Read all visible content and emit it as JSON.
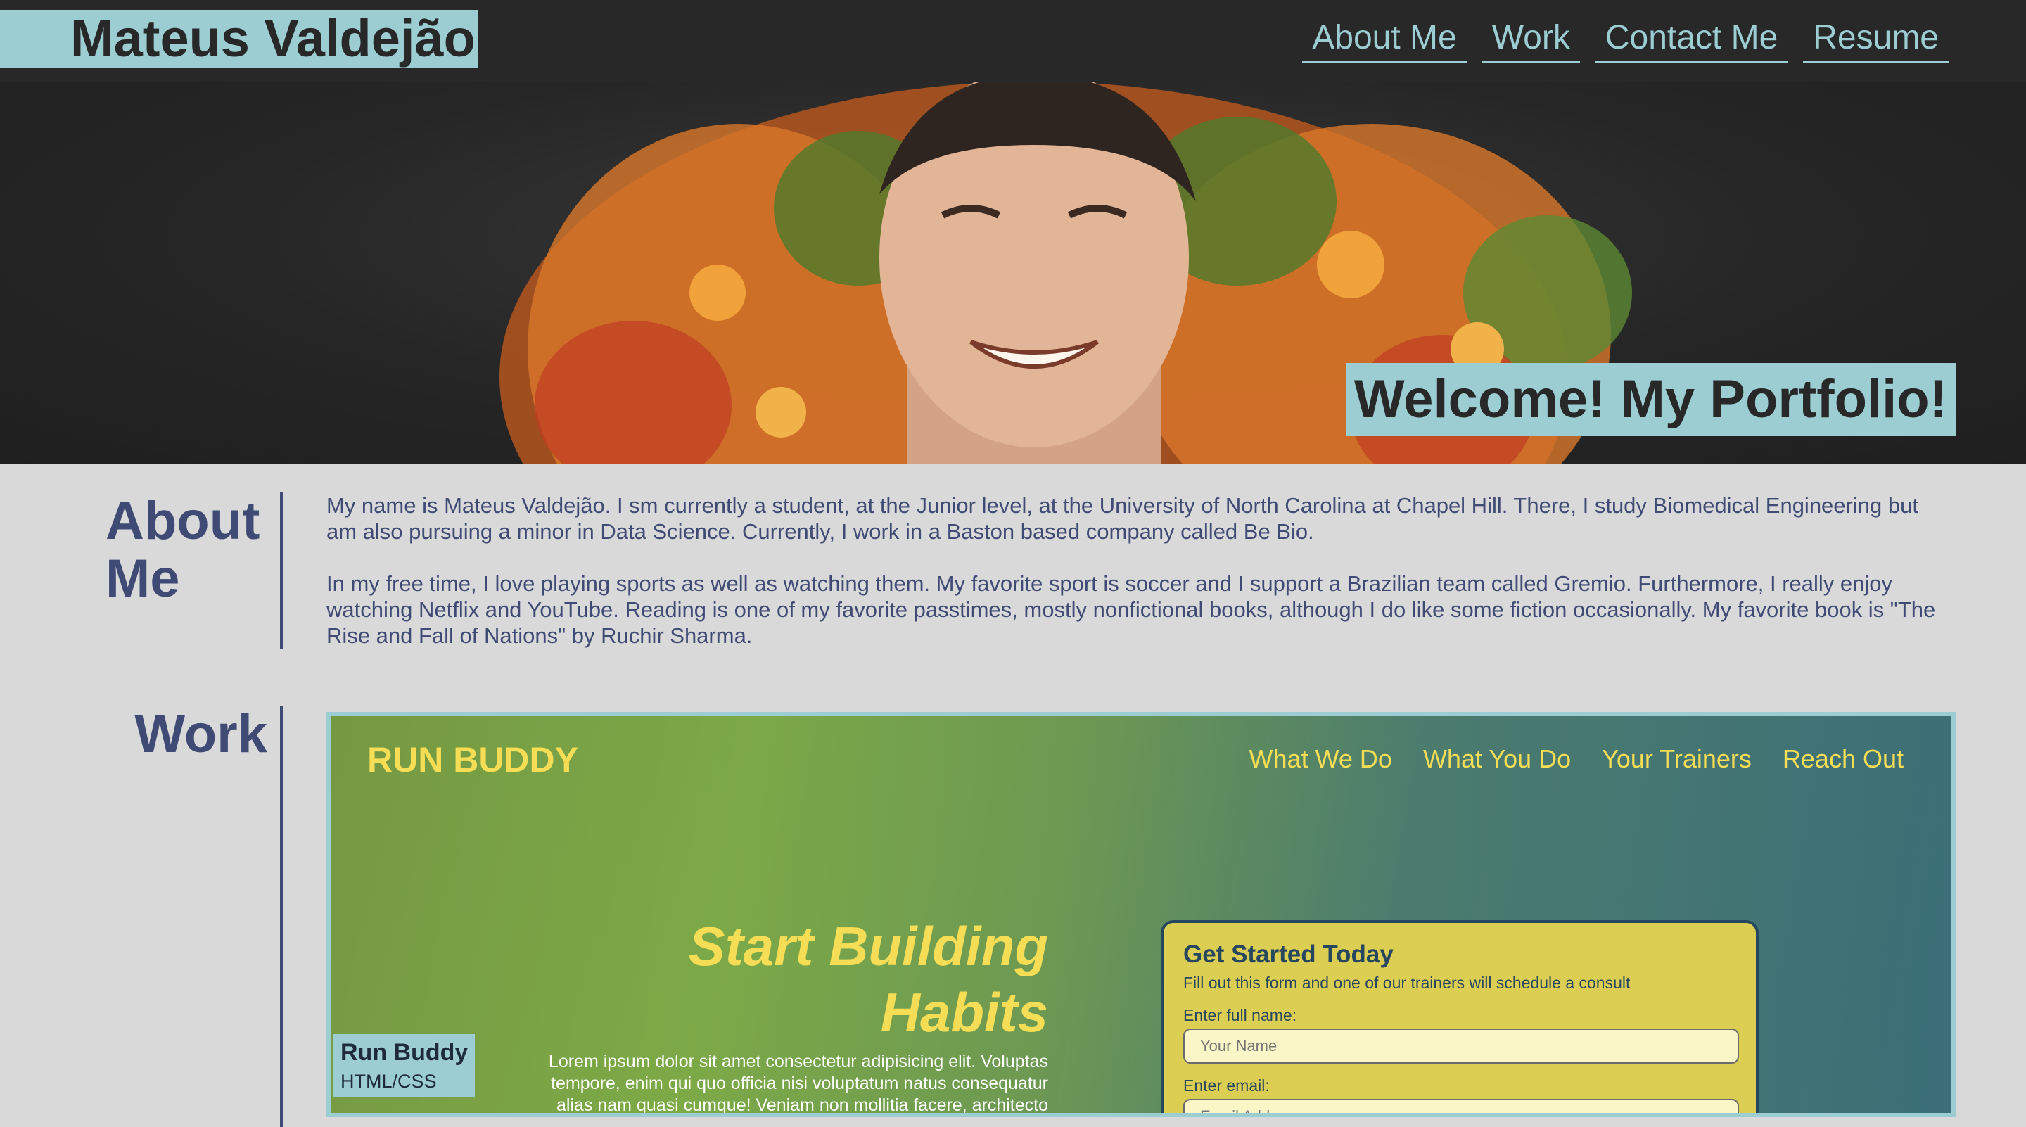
{
  "header": {
    "brand": "Mateus Valdejão",
    "nav": [
      "About Me",
      "Work",
      "Contact Me",
      "Resume"
    ]
  },
  "hero": {
    "welcome": "Welcome! My Portfolio!"
  },
  "about": {
    "title": "About Me",
    "paragraphs": [
      "My name is Mateus Valdejão. I sm currently a student, at the Junior level, at the University of North Carolina at Chapel Hill. There, I study Biomedical Engineering but am also pursuing a minor in Data Science. Currently, I work in a Baston based company called Be Bio.",
      "In my free time, I love playing sports as well as watching them. My favorite sport is soccer and I support a Brazilian team called Gremio. Furthermore, I really enjoy watching Netflix and YouTube. Reading is one of my favorite passtimes, mostly nonfictional books, although I do like some fiction occasionally. My favorite book is \"The Rise and Fall of Nations\" by Ruchir Sharma."
    ]
  },
  "work": {
    "title": "Work",
    "project": {
      "logo": "RUN BUDDY",
      "nav": [
        "What We Do",
        "What You Do",
        "Your Trainers",
        "Reach Out"
      ],
      "headline_1": "Start Building",
      "headline_2": "Habits",
      "lorem": "Lorem ipsum dolor sit amet consectetur adipisicing elit. Voluptas tempore, enim qui quo officia nisi voluptatum natus consequatur alias nam quasi cumque! Veniam non mollitia facere, architecto",
      "form": {
        "title": "Get Started Today",
        "subtitle": "Fill out this form and one of our trainers will schedule a consult",
        "name_label": "Enter full name:",
        "name_placeholder": "Your Name",
        "email_label": "Enter email:",
        "email_placeholder": "Email Address"
      },
      "tag_title": "Run Buddy",
      "tag_sub": "HTML/CSS"
    }
  },
  "colors": {
    "accent": "#9bcdd2",
    "header_bg": "#282828",
    "section_text": "#3f4a75",
    "run_buddy_yellow": "#f5dd55"
  }
}
